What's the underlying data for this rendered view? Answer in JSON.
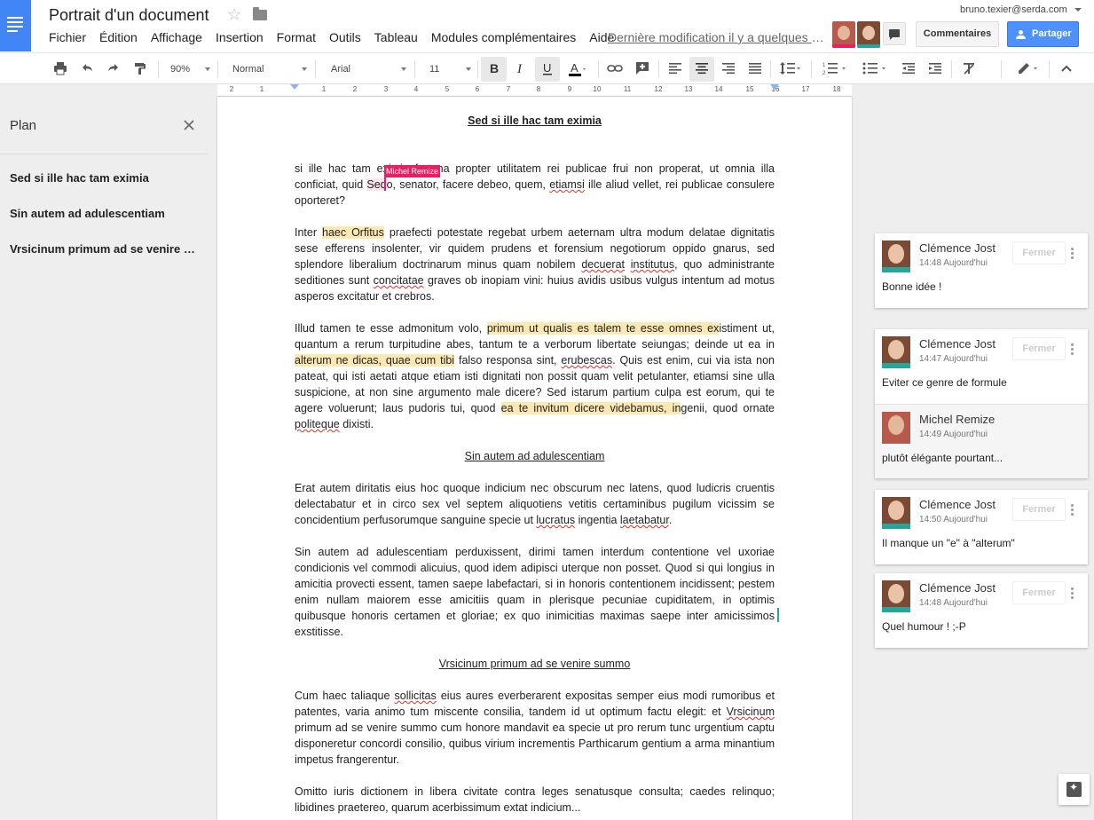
{
  "header": {
    "title": "Portrait d'un document",
    "last_edit": "Dernière modification il y a quelques secondes",
    "user_email": "bruno.texier@serda.com",
    "comments_label": "Commentaires",
    "share_label": "Partager",
    "collaborators": [
      "Michel Remize",
      "Clémence Jost"
    ]
  },
  "menu": [
    "Fichier",
    "Édition",
    "Affichage",
    "Insertion",
    "Format",
    "Outils",
    "Tableau",
    "Modules complémentaires",
    "Aide"
  ],
  "toolbar": {
    "zoom": "90%",
    "style": "Normal",
    "font": "Arial",
    "size": "11"
  },
  "ruler": [
    "2",
    "1",
    "1",
    "2",
    "3",
    "4",
    "5",
    "6",
    "7",
    "8",
    "9",
    "10",
    "11",
    "12",
    "13",
    "14",
    "15",
    "16",
    "17",
    "18"
  ],
  "outline": {
    "title": "Plan",
    "items": [
      "Sed si ille hac tam eximia",
      "Sin autem ad adulescentiam",
      "Vrsicinum primum ad se venire summo"
    ]
  },
  "document": {
    "title": "Sed si ille hac tam eximia",
    "p1": {
      "a": "si ille hac tam eximia fortuna propter utilitatem rei publicae frui non properat, ut omnia illa conficiat, quid ",
      "b": "Sed",
      "c": "o, senator, facere debeo, quem, ",
      "d": "etiamsi",
      "e": " ille aliud vellet, rei publicae consulere oporteret?"
    },
    "p2": {
      "a": "Inter ",
      "b": "haec Orfitus",
      "c": " praefecti potestate regebat urbem aeternam ultra modum delatae dignitatis sese efferens insolenter, vir quidem prudens et forensium negotiorum oppido gnarus, sed splendore liberalium doctrinarum minus quam nobilem ",
      "d": "decuerat",
      "e": " ",
      "f": "institutus",
      "g": ", quo administrante seditiones sunt ",
      "h": "concitatae",
      "i": " graves ob inopiam vini: huius avidis usibus vulgus intentum ad motus asperos excitatur et crebros."
    },
    "p3": {
      "a": "Illud tamen te esse admonitum volo, ",
      "b": "primum ut qualis es talem te esse omnes ex",
      "c": "istiment ut, quantum a rerum turpitudine abes, tantum te a verborum libertate seiungas; deinde ut ea in ",
      "d": "alterum ne dicas, quae cum tibi",
      "e": " falso responsa sint, ",
      "f": "erubescas",
      "g": ". Quis est enim, cui via ista non pateat, qui isti aetati atque etiam isti dignitati non possit quam velit petulanter, etiamsi sine ulla suspicione, at non sine argumento male dicere? Sed istarum partium culpa est eorum, qui te agere voluerunt; laus pudoris tui, quod ",
      "h": "ea te invitum dicere videbamus, in",
      "i": "genii, quod ornate ",
      "j": "politeque",
      "k": " dixisti."
    },
    "h2": "Sin autem ad adulescentiam",
    "p4": {
      "a": "Erat autem diritatis eius hoc quoque indicium nec obscurum nec latens, quod ludicris cruentis delectabatur et in circo sex vel septem aliquotiens vetitis certaminibus pugilum vicissim se concidentium perfusorumque sanguine specie ut ",
      "b": "lucratus",
      "c": " ingentia ",
      "d": "laetabatur",
      "e": "."
    },
    "p5": "Sin autem ad adulescentiam perduxissent, dirimi tamen interdum contentione vel uxoriae condicionis vel commodi alicuius, quod idem adipisci uterque non posset. Quod si qui longius in amicitia provecti essent, tamen saepe labefactari, si in honoris contentionem incidissent; pestem enim nullam maiorem esse amicitiis quam in plerisque pecuniae cupiditatem, in optimis quibusque honoris certamen et gloriae; ex quo inimicitias maximas saepe inter amicissimos exstitisse.",
    "h3": "Vrsicinum primum ad se venire summo",
    "p6": {
      "a": "Cum haec taliaque ",
      "b": "sollicitas",
      "c": " eius aures everberarent expositas semper eius modi rumoribus et patentes, varia animo tum miscente consilia, tandem id ut optimum factu elegit: et ",
      "d": "Vrsicinum",
      "e": " primum ad se venire summo cum honore mandavit ea specie ut pro rerum tunc urgentium captu disponeretur concordi consilio, quibus virium incrementis Parthicarum gentium a arma minantium impetus frangerentur."
    },
    "p7": "Omitto iuris dictionem in libera civitate contra leges senatusque consulta; caedes relinquo; libidines praetereo, quarum acerbissimum extat indicium...",
    "cursor_label": "Michel Remize"
  },
  "comments": [
    {
      "entries": [
        {
          "author": "Clémence Jost",
          "time": "14:48 Aujourd'hui",
          "text": "Bonne idée !"
        }
      ],
      "close": "Fermer"
    },
    {
      "entries": [
        {
          "author": "Clémence Jost",
          "time": "14:47 Aujourd'hui",
          "text": "Eviter ce genre de formule"
        },
        {
          "author": "Michel Remize",
          "time": "14:49 Aujourd'hui",
          "text": "plutôt élégante pourtant..."
        }
      ],
      "close": "Fermer"
    },
    {
      "entries": [
        {
          "author": "Clémence Jost",
          "time": "14:50 Aujourd'hui",
          "text": "Il manque un \"e\" à \"alterum\""
        }
      ],
      "close": "Fermer"
    },
    {
      "entries": [
        {
          "author": "Clémence Jost",
          "time": "14:48 Aujourd'hui",
          "text": "Quel humour ! ;-P"
        }
      ],
      "close": "Fermer"
    }
  ],
  "colors": {
    "brand": "#4285f4",
    "share": "#4d90fe",
    "highlight": "#fce8b2",
    "cursor": "#e91e63",
    "avatar_bar": "#26a69a"
  }
}
